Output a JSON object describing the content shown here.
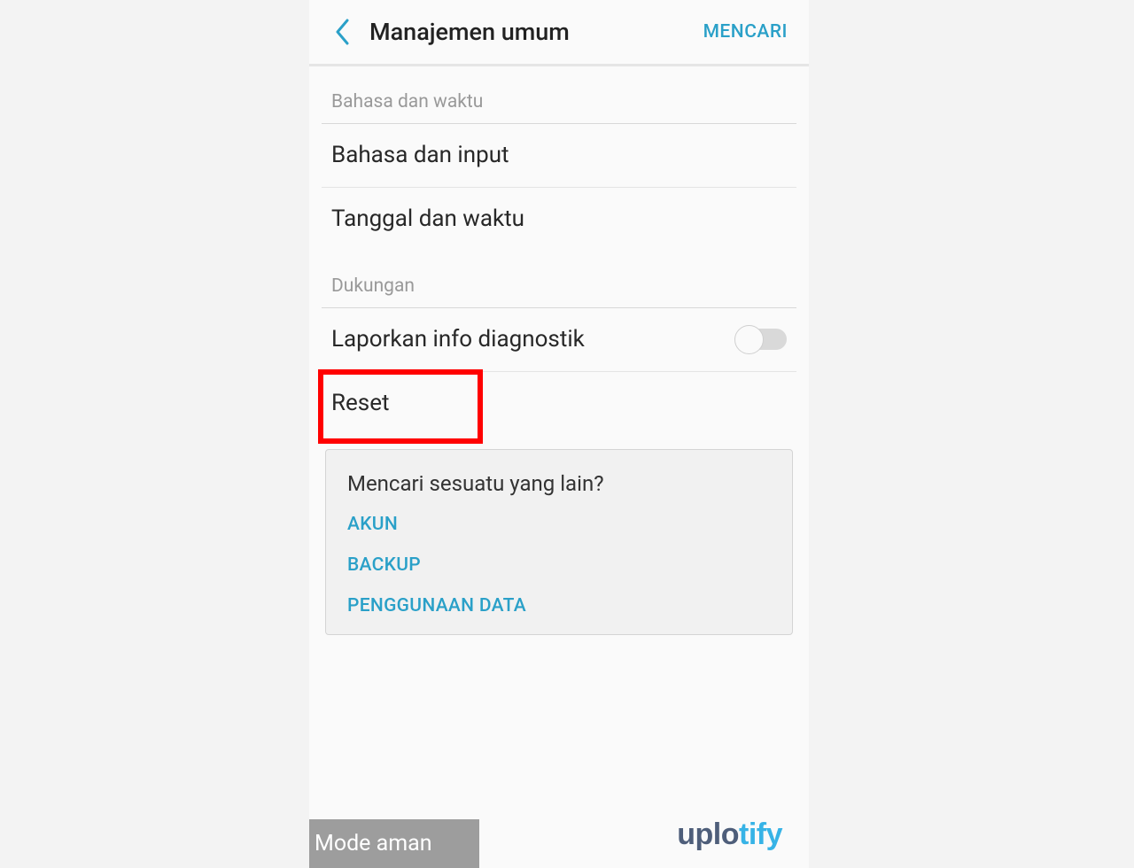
{
  "header": {
    "title": "Manajemen umum",
    "search": "MENCARI"
  },
  "sections": {
    "langtime": {
      "label": "Bahasa dan waktu",
      "language_input": "Bahasa dan input",
      "date_time": "Tanggal dan waktu"
    },
    "support": {
      "label": "Dukungan",
      "diagnostic": "Laporkan info diagnostik",
      "reset": "Reset"
    }
  },
  "card": {
    "title": "Mencari sesuatu yang lain?",
    "links": {
      "akun": "AKUN",
      "backup": "BACKUP",
      "data": "PENGGUNAAN DATA"
    }
  },
  "safe_mode": "Mode aman",
  "watermark": {
    "part1": "uplo",
    "part2": "tify"
  },
  "colors": {
    "accent": "#2aa0c8",
    "highlight": "#ff0000"
  }
}
